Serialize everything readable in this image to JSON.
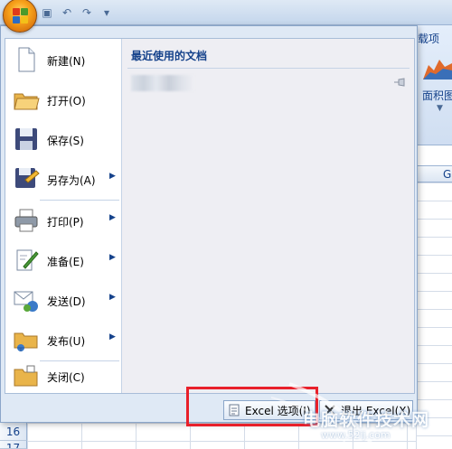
{
  "app": {
    "ribbon_tab_partial": "载项",
    "chart_button_label": "面积图",
    "column_header_partial": "G",
    "row_numbers": [
      "16",
      "17"
    ]
  },
  "office_menu": {
    "items": [
      {
        "label": "新建(N)",
        "icon": "new-document-icon",
        "submenu": false
      },
      {
        "label": "打开(O)",
        "icon": "open-folder-icon",
        "submenu": false
      },
      {
        "label": "保存(S)",
        "icon": "save-floppy-icon",
        "submenu": false
      },
      {
        "label": "另存为(A)",
        "icon": "save-as-icon",
        "submenu": true
      },
      {
        "label": "打印(P)",
        "icon": "printer-icon",
        "submenu": true
      },
      {
        "label": "准备(E)",
        "icon": "prepare-document-icon",
        "submenu": true
      },
      {
        "label": "发送(D)",
        "icon": "send-icon",
        "submenu": true
      },
      {
        "label": "发布(U)",
        "icon": "publish-icon",
        "submenu": true
      },
      {
        "label": "关闭(C)",
        "icon": "close-folder-icon",
        "submenu": false
      }
    ],
    "recent_documents_title": "最近使用的文档",
    "options_button_label": "Excel 选项(I)",
    "exit_button_label": "退出 Excel(X)"
  },
  "watermark": {
    "text": "电脑软件技术网",
    "sub": "www.52ij.com"
  },
  "colors": {
    "highlight": "#e8202a",
    "menu_text": "#15428b",
    "office_orange": "#f7a21b"
  }
}
